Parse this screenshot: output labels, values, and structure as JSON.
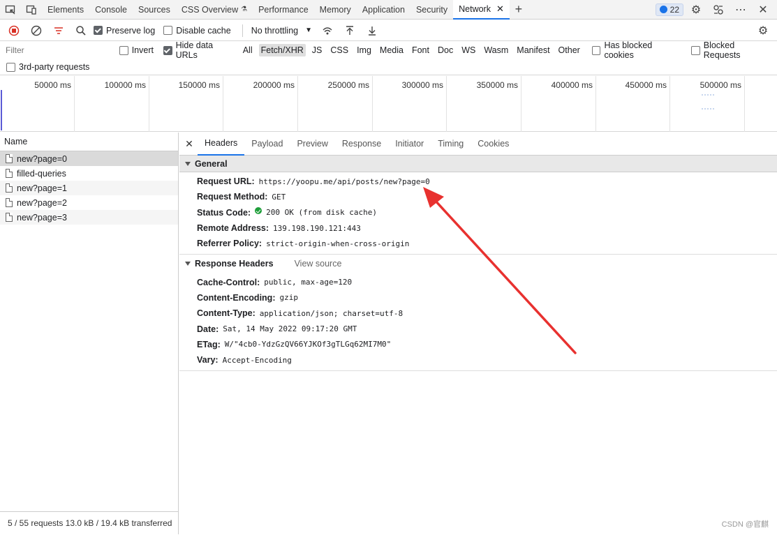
{
  "top_tabs": [
    "Elements",
    "Console",
    "Sources",
    "CSS Overview",
    "Performance",
    "Memory",
    "Application",
    "Security",
    "Network"
  ],
  "active_tab": "Network",
  "issues_count": "22",
  "toolbar": {
    "preserve_log": "Preserve log",
    "disable_cache": "Disable cache",
    "throttling": "No throttling"
  },
  "filter": {
    "placeholder": "Filter",
    "invert": "Invert",
    "hide_data_urls": "Hide data URLs",
    "types": [
      "All",
      "Fetch/XHR",
      "JS",
      "CSS",
      "Img",
      "Media",
      "Font",
      "Doc",
      "WS",
      "Wasm",
      "Manifest",
      "Other"
    ],
    "active_type": "Fetch/XHR",
    "has_blocked_cookies": "Has blocked cookies",
    "blocked_requests": "Blocked Requests",
    "third_party": "3rd-party requests"
  },
  "timeline_ticks": [
    "50000 ms",
    "100000 ms",
    "150000 ms",
    "200000 ms",
    "250000 ms",
    "300000 ms",
    "350000 ms",
    "400000 ms",
    "450000 ms",
    "500000 ms"
  ],
  "request_list": {
    "header": "Name",
    "items": [
      "new?page=0",
      "filled-queries",
      "new?page=1",
      "new?page=2",
      "new?page=3"
    ],
    "summary": "5 / 55 requests  13.0 kB / 19.4 kB transferred"
  },
  "detail_tabs": [
    "Headers",
    "Payload",
    "Preview",
    "Response",
    "Initiator",
    "Timing",
    "Cookies"
  ],
  "general": {
    "title": "General",
    "rows": [
      {
        "k": "Request URL:",
        "v": "https://yoopu.me/api/posts/new?page=0"
      },
      {
        "k": "Request Method:",
        "v": "GET"
      },
      {
        "k": "Status Code:",
        "v": "200 OK (from disk cache)"
      },
      {
        "k": "Remote Address:",
        "v": "139.198.190.121:443"
      },
      {
        "k": "Referrer Policy:",
        "v": "strict-origin-when-cross-origin"
      }
    ]
  },
  "response_headers": {
    "title": "Response Headers",
    "view_source": "View source",
    "rows": [
      {
        "k": "Cache-Control:",
        "v": "public, max-age=120"
      },
      {
        "k": "Content-Encoding:",
        "v": "gzip"
      },
      {
        "k": "Content-Type:",
        "v": "application/json; charset=utf-8"
      },
      {
        "k": "Date:",
        "v": "Sat, 14 May 2022 09:17:20 GMT"
      },
      {
        "k": "ETag:",
        "v": "W/\"4cb0-YdzGzQV66YJKOf3gTLGq62MI7M0\""
      },
      {
        "k": "Vary:",
        "v": "Accept-Encoding"
      }
    ]
  },
  "watermark": "CSDN @官麒",
  "colors": {
    "accent": "#1a73e8",
    "arrow": "#e8312f",
    "record": "#d93025"
  }
}
